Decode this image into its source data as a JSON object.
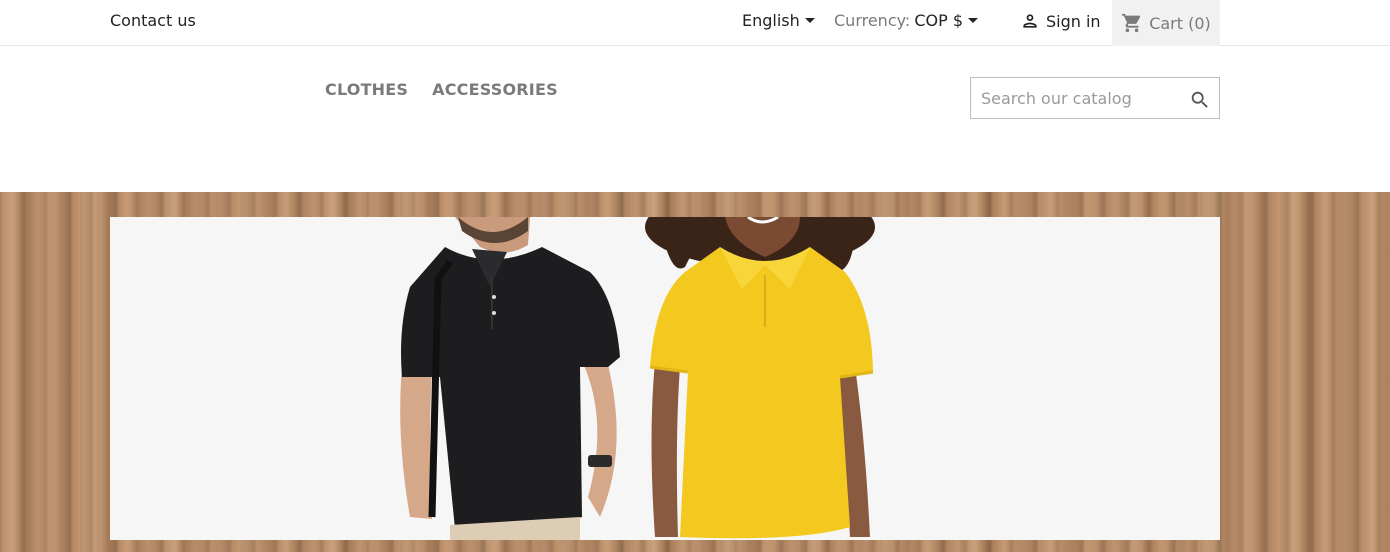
{
  "topbar": {
    "contact_label": "Contact us",
    "language": "English",
    "currency_label": "Currency:",
    "currency_value": "COP $",
    "signin_label": "Sign in",
    "cart_label": "Cart (0)"
  },
  "nav": {
    "items": [
      {
        "label": "CLOTHES"
      },
      {
        "label": "ACCESSORIES"
      }
    ]
  },
  "search": {
    "placeholder": "Search our catalog"
  },
  "colors": {
    "accent_text": "#7a7a7a",
    "cart_bg": "#f1f1f1",
    "wood": "#b88c67",
    "shirt_black": "#1d1d1f",
    "shirt_yellow": "#f3c81f"
  },
  "icons": {
    "language_caret": "caret-down-icon",
    "currency_caret": "caret-down-icon",
    "signin": "person-icon",
    "cart": "shopping-cart-icon",
    "search": "search-icon"
  }
}
